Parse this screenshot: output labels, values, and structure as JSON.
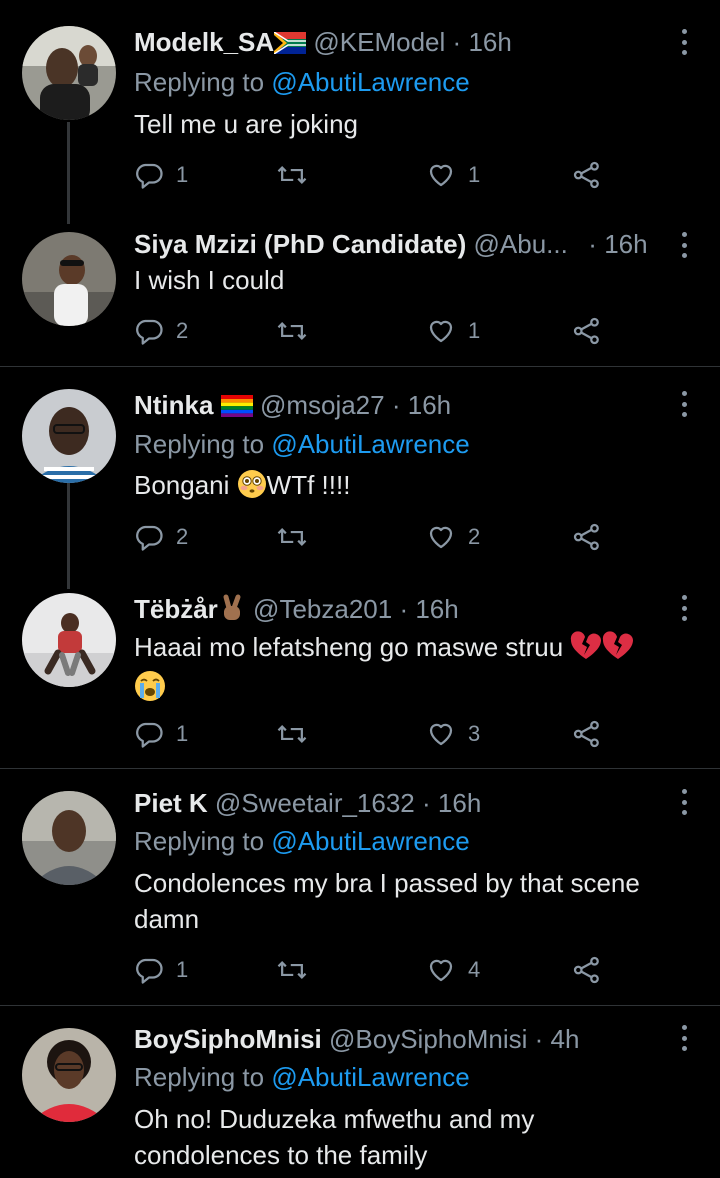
{
  "tweets": [
    {
      "name": "Modelk_SA",
      "handle": "@KEModel",
      "dot": "·",
      "time": "16h",
      "replying_label": "Replying to",
      "replying_to": "@AbutiLawrence",
      "text": "Tell me u are joking",
      "reply_count": "1",
      "retweet_count": "",
      "like_count": "1"
    },
    {
      "name": "Siya Mzizi (PhD Candidate)",
      "handle": "@Abu...",
      "dot": "·",
      "time": "16h",
      "text": "I wish I could",
      "reply_count": "2",
      "retweet_count": "",
      "like_count": "1"
    },
    {
      "name": "Ntinka",
      "handle": "@msoja27",
      "dot": "·",
      "time": "16h",
      "replying_label": "Replying to",
      "replying_to": "@AbutiLawrence",
      "text_before": "Bongani ",
      "text_after": "WTf !!!!",
      "reply_count": "2",
      "retweet_count": "",
      "like_count": "2"
    },
    {
      "name": "Tëbżår",
      "handle": "@Tebza201",
      "dot": "·",
      "time": "16h",
      "text": "Haaai mo lefatsheng go maswe struu",
      "reply_count": "1",
      "retweet_count": "",
      "like_count": "3"
    },
    {
      "name": "Piet K",
      "handle": "@Sweetair_1632",
      "dot": "·",
      "time": "16h",
      "replying_label": "Replying to",
      "replying_to": "@AbutiLawrence",
      "text_line1": "Condolences my bra I passed by that scene",
      "text_line2": "damn",
      "reply_count": "1",
      "retweet_count": "",
      "like_count": "4"
    },
    {
      "name": "BoySiphoMnisi",
      "handle": "@BoySiphoMnisi",
      "dot": "·",
      "time": "4h",
      "replying_label": "Replying to",
      "replying_to": "@AbutiLawrence",
      "text_line1": "Oh no! Duduzeka mfwethu and my",
      "text_line2": "condolences to the family"
    }
  ],
  "colors": {
    "background": "#000000",
    "primary_text": "#e7e9ea",
    "secondary_text": "#8b98a5",
    "mention": "#1d9bf0",
    "divider": "#2f3336"
  }
}
